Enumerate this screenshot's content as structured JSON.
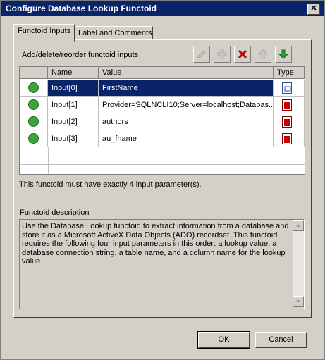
{
  "window": {
    "title": "Configure Database Lookup Functoid",
    "close_glyph": "✕"
  },
  "tabs": [
    {
      "label": "Functoid Inputs",
      "active": true
    },
    {
      "label": "Label and Comments",
      "active": false
    }
  ],
  "inputs_section": {
    "label": "Add/delete/reorder functoid inputs"
  },
  "toolbar": [
    {
      "icon": "edit-icon",
      "enabled": false
    },
    {
      "icon": "add-icon",
      "enabled": false
    },
    {
      "icon": "delete-icon",
      "enabled": true
    },
    {
      "icon": "move-up-icon",
      "enabled": false
    },
    {
      "icon": "move-down-icon",
      "enabled": true
    }
  ],
  "grid": {
    "columns": [
      "Name",
      "Value",
      "Type"
    ],
    "rows": [
      {
        "name": "Input[0]",
        "value": "FirstName",
        "type_icon": "link-icon",
        "selected": true
      },
      {
        "name": "Input[1]",
        "value": "Provider=SQLNCLI10;Server=localhost;Databas...",
        "type_icon": "constant-icon",
        "selected": false
      },
      {
        "name": "Input[2]",
        "value": "authors",
        "type_icon": "constant-icon",
        "selected": false
      },
      {
        "name": "Input[3]",
        "value": "au_fname",
        "type_icon": "constant-icon",
        "selected": false
      }
    ]
  },
  "validation_note": "This functoid must have exactly 4 input parameter(s).",
  "description": {
    "label": "Functoid description",
    "text": "Use the Database Lookup functoid to extract information from a database and store it as a Microsoft ActiveX Data Objects (ADO) recordset. This functoid requires the following four input parameters in this order: a lookup value, a database connection string, a table name, and a column name for the lookup value."
  },
  "buttons": {
    "ok": "OK",
    "cancel": "Cancel"
  },
  "colors": {
    "titlebar": "#0a246a",
    "selection": "#0a246a",
    "check": "#3aa53a",
    "delete": "#cc0000",
    "move_down": "#2ea02e"
  }
}
